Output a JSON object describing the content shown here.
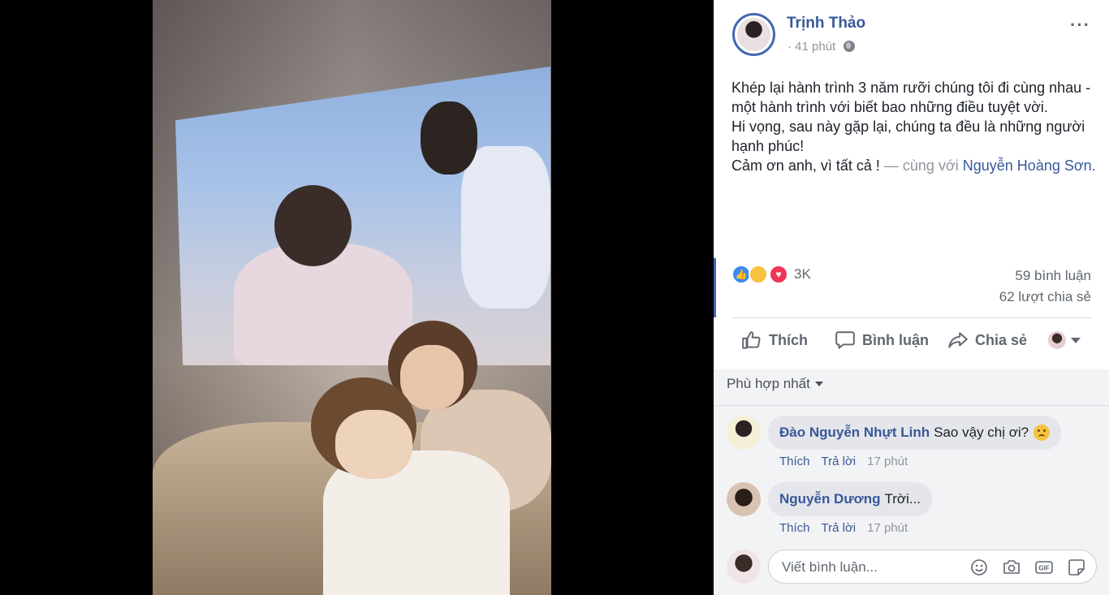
{
  "post": {
    "author": "Trịnh Thảo",
    "time": "41 phút",
    "time_separator": "·",
    "text_lines": [
      "Khép lại hành trình 3 năm rưỡi chúng tôi đi cùng nhau - một hành trình với biết bao những điều tuyệt vời.",
      "Hi vọng, sau này gặp lại, chúng ta đều là những người hạnh phúc!",
      "Cảm ơn anh, vì tất cả !"
    ],
    "tag_prefix": "— cùng với",
    "tagged_person": "Nguyễn Hoàng Sơn",
    "tag_suffix": ".",
    "more_icon": "···"
  },
  "stats": {
    "reaction_count": "3K",
    "comments": "59 bình luận",
    "shares": "62 lượt chia sẻ"
  },
  "actions": {
    "like": "Thích",
    "comment": "Bình luận",
    "share": "Chia sẻ"
  },
  "comments_section": {
    "sort_label": "Phù hợp nhất",
    "items": [
      {
        "name": "Đào Nguyễn Nhựt Linh",
        "text": "Sao vậy chị ơi?",
        "like": "Thích",
        "reply": "Trả lời",
        "time": "17 phút"
      },
      {
        "name": "Nguyễn Dương",
        "text": "Trời...",
        "like": "Thích",
        "reply": "Trả lời",
        "time": "17 phút"
      }
    ],
    "composer_placeholder": "Viết bình luận..."
  },
  "colors": {
    "link": "#385898",
    "accent": "#4267b2",
    "muted": "#90949c"
  }
}
